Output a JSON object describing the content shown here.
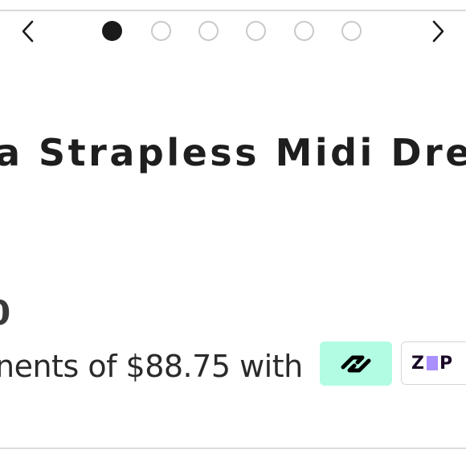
{
  "carousel": {
    "prev_icon": "chevron-left-icon",
    "next_icon": "chevron-right-icon",
    "slide_count": 6,
    "active_slide": 1
  },
  "product": {
    "title": "a Strapless Midi Dre",
    "price": "0",
    "installment_text": "nents of $88.75 with"
  },
  "payment_badges": {
    "afterpay": {
      "icon": "afterpay-logo-icon",
      "color": "#b2fce4"
    },
    "zip": {
      "label": "ZIP",
      "accent": "#aa8fff"
    }
  }
}
